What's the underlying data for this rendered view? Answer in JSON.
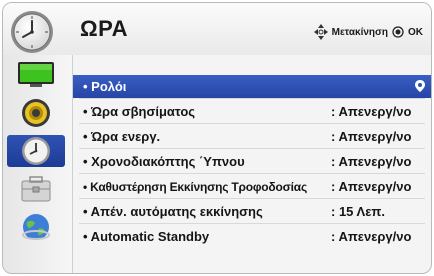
{
  "header": {
    "title": "ΩΡΑ",
    "help_move": "Μετακίνηση",
    "help_ok": "OK"
  },
  "sidebar": {
    "items": [
      {
        "name": "picture-menu-icon"
      },
      {
        "name": "audio-menu-icon"
      },
      {
        "name": "time-menu-icon",
        "active": true
      },
      {
        "name": "setup-menu-icon"
      },
      {
        "name": "network-menu-icon"
      }
    ]
  },
  "menu": {
    "items": [
      {
        "label": "• Ρολόι",
        "value": "",
        "selected": true
      },
      {
        "label": "• Ώρα σβησίματος",
        "value": ": Απενεργ/νο"
      },
      {
        "label": "• Ώρα ενεργ.",
        "value": ": Απενεργ/νο"
      },
      {
        "label": "• Χρονοδιακόπτης ΄Υπνου",
        "value": ": Απενεργ/νο"
      },
      {
        "label": "• Καθυστέρηση Εκκίνησης Τροφοδοσίας",
        "value": ": Απενεργ/νο"
      },
      {
        "label": "• Απέν. αυτόματης εκκίνησης",
        "value": ": 15 Λεπ."
      },
      {
        "label": "• Automatic Standby",
        "value": ": Απενεργ/νο"
      }
    ]
  },
  "colors": {
    "selection": "#2f53b5",
    "background": "#f4f4f4"
  }
}
